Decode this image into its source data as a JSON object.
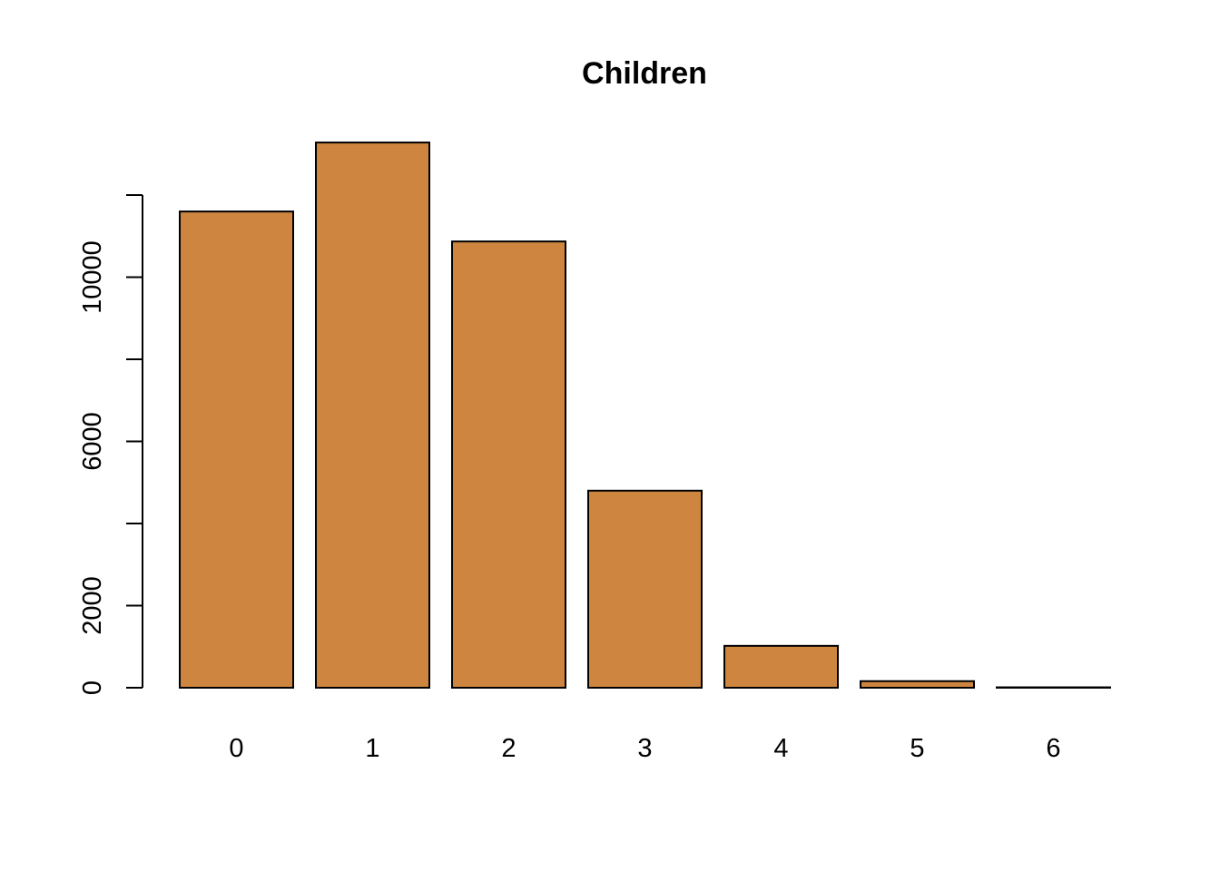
{
  "chart_data": {
    "type": "bar",
    "title": "Children",
    "xlabel": "",
    "ylabel": "",
    "categories": [
      "0",
      "1",
      "2",
      "3",
      "4",
      "5",
      "6"
    ],
    "values": [
      11600,
      13280,
      10870,
      4800,
      1020,
      160,
      10
    ],
    "ylim": [
      0,
      12000
    ],
    "yticks": [
      0,
      2000,
      4000,
      6000,
      8000,
      10000,
      12000
    ],
    "ytick_labels": [
      "0",
      "2000",
      "",
      "6000",
      "",
      "10000",
      ""
    ],
    "grid": false,
    "legend": "none",
    "bar_color": "#CD853F",
    "border_color": "#000000"
  }
}
